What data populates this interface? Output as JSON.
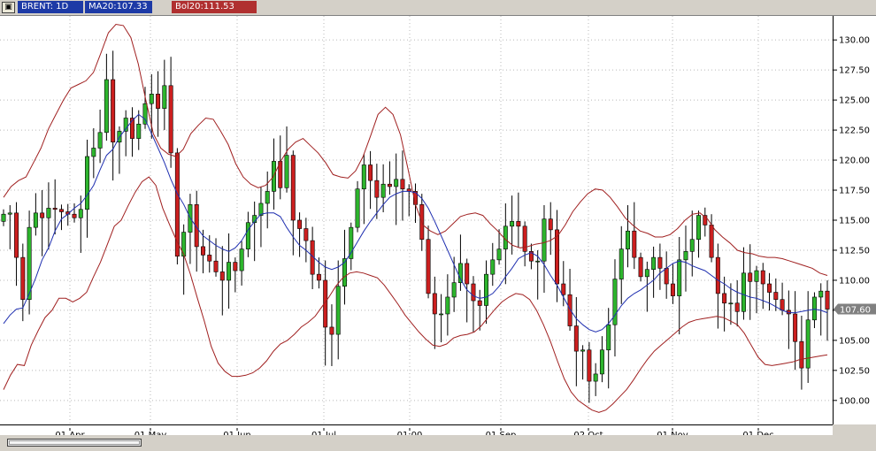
{
  "header": {
    "icon": "window-icon",
    "symbol_label": "BRENT: 1D",
    "ma_label": "MA20:107.33",
    "bol_label": "Bol20:111.53"
  },
  "colors": {
    "bull": "#2db52d",
    "bear": "#cc1f1f",
    "ma": "#1f2fb0",
    "bollinger": "#a02020",
    "grid": "#b8b8b8",
    "last_price_bg": "#808080"
  },
  "chart_data": {
    "type": "candlestick",
    "ylim": [
      98,
      132
    ],
    "y_ticks": [
      "100.00",
      "102.50",
      "105.00",
      "107.50",
      "110.00",
      "112.50",
      "115.00",
      "117.50",
      "120.00",
      "122.50",
      "125.00",
      "127.50",
      "130.00"
    ],
    "x_tick_labels": [
      "01 Apr",
      "01 May",
      "01 Jun",
      "01 Jul",
      "01:00",
      "01 Sep",
      "02 Oct",
      "01 Nov",
      "01 Dec"
    ],
    "last_price": "107.60",
    "grid": true,
    "close": [
      115.5,
      115.6,
      111.9,
      108.4,
      114.4,
      115.6,
      115.2,
      116.0,
      115.9,
      115.7,
      115.5,
      115.2,
      115.9,
      120.3,
      121.0,
      122.3,
      126.7,
      121.5,
      122.4,
      123.5,
      121.8,
      123.0,
      124.7,
      125.5,
      124.3,
      126.2,
      120.6,
      112.0,
      114.0,
      116.3,
      112.8,
      112.1,
      111.6,
      110.7,
      110.0,
      111.5,
      110.8,
      112.6,
      114.8,
      115.4,
      116.4,
      117.4,
      119.9,
      117.7,
      120.4,
      115.0,
      114.3,
      113.3,
      110.5,
      110.0,
      106.1,
      105.5,
      109.5,
      111.8,
      114.4,
      117.6,
      119.6,
      118.3,
      116.9,
      118.0,
      117.8,
      118.4,
      117.6,
      117.4,
      116.3,
      113.4,
      108.9,
      107.2,
      107.2,
      108.6,
      109.8,
      111.4,
      109.7,
      108.3,
      107.9,
      110.5,
      111.7,
      112.6,
      114.5,
      114.9,
      114.5,
      112.4,
      111.6,
      111.6,
      115.1,
      114.2,
      109.7,
      108.8,
      106.2,
      104.1,
      104.2,
      101.6,
      102.2,
      104.2,
      106.3,
      110.1,
      112.6,
      114.1,
      111.9,
      110.3,
      110.9,
      111.9,
      111.0,
      109.7,
      108.7,
      111.7,
      112.4,
      113.4,
      115.4,
      114.6,
      111.9,
      108.9,
      108.1,
      108.1,
      107.4,
      110.6,
      109.9,
      110.8,
      109.7,
      109.0,
      108.4,
      107.5,
      107.2,
      104.9,
      102.7,
      106.7,
      108.6,
      109.1,
      107.6
    ],
    "ma20": [
      106.4,
      107.1,
      107.6,
      107.7,
      108.9,
      110.2,
      111.7,
      112.7,
      114.1,
      115.1,
      115.5,
      116.0,
      116.4,
      117.1,
      117.9,
      119.2,
      120.4,
      120.9,
      121.9,
      122.6,
      123.3,
      123.8,
      123.4,
      122.2,
      121.0,
      119.8,
      118.4,
      117.2,
      116.3,
      115.2,
      114.4,
      113.7,
      113.3,
      112.9,
      112.6,
      112.4,
      112.7,
      113.3,
      114.2,
      114.9,
      115.5,
      115.6,
      115.6,
      115.3,
      114.4,
      113.6,
      112.9,
      112.5,
      112.0,
      111.5,
      111.1,
      110.9,
      111.1,
      111.5,
      112.3,
      113.2,
      114.1,
      114.9,
      115.6,
      116.3,
      116.9,
      117.2,
      117.4,
      117.4,
      117.3,
      116.8,
      116.0,
      114.9,
      113.7,
      112.5,
      111.3,
      110.1,
      109.2,
      108.7,
      108.5,
      108.6,
      108.9,
      109.5,
      110.3,
      111.0,
      111.8,
      112.1,
      112.3,
      112.0,
      111.3,
      110.4,
      109.6,
      108.6,
      107.6,
      106.8,
      106.3,
      105.9,
      105.7,
      105.9,
      106.4,
      107.1,
      107.9,
      108.5,
      108.9,
      109.2,
      109.6,
      110.0,
      110.6,
      111.0,
      111.4,
      111.6,
      111.5,
      111.2,
      111.0,
      110.8,
      110.4,
      110.0,
      109.7,
      109.3,
      109.0,
      108.8,
      108.6,
      108.5,
      108.3,
      108.1,
      107.8,
      107.5,
      107.3,
      107.3,
      107.4,
      107.5,
      107.6,
      107.5,
      107.3
    ],
    "bollinger_upper": [
      116.9,
      117.8,
      118.3,
      118.6,
      119.8,
      121.0,
      122.6,
      123.8,
      125.0,
      126.0,
      126.3,
      126.6,
      127.3,
      128.9,
      130.6,
      131.3,
      131.2,
      130.2,
      128.0,
      125.0,
      122.2,
      121.0,
      120.5,
      120.3,
      120.9,
      122.2,
      122.9,
      123.5,
      123.4,
      122.4,
      121.3,
      119.7,
      118.6,
      118.0,
      117.7,
      117.9,
      118.6,
      119.9,
      120.9,
      121.5,
      121.8,
      121.2,
      120.6,
      119.8,
      118.8,
      118.6,
      118.5,
      119.1,
      120.3,
      122.0,
      123.8,
      124.4,
      123.8,
      122.1,
      119.3,
      116.3,
      114.6,
      114.1,
      113.8,
      114.1,
      114.7,
      115.3,
      115.5,
      115.6,
      115.4,
      114.7,
      114.1,
      113.4,
      112.9,
      112.7,
      112.8,
      113.0,
      113.1,
      113.3,
      113.7,
      114.6,
      115.7,
      116.5,
      117.2,
      117.6,
      117.5,
      116.9,
      116.1,
      115.2,
      114.6,
      114.1,
      113.9,
      113.6,
      113.6,
      113.8,
      114.3,
      115.0,
      115.5,
      115.6,
      115.1,
      114.2,
      113.6,
      113.1,
      112.5,
      112.3,
      112.2,
      112.0,
      111.9,
      111.9,
      111.8,
      111.6,
      111.4,
      111.2,
      111.0,
      110.6,
      110.4
    ],
    "bollinger_lower": [
      100.9,
      102.1,
      103.0,
      102.9,
      104.6,
      105.8,
      106.9,
      107.5,
      108.5,
      108.5,
      108.2,
      108.5,
      109.0,
      110.3,
      111.5,
      113.0,
      114.5,
      115.0,
      116.2,
      117.3,
      118.2,
      118.6,
      117.9,
      116.0,
      114.6,
      113.3,
      112.2,
      110.5,
      108.5,
      106.6,
      104.5,
      103.1,
      102.4,
      102.0,
      102.0,
      102.1,
      102.3,
      102.7,
      103.3,
      104.1,
      104.7,
      105.0,
      105.5,
      106.1,
      106.5,
      107.0,
      107.8,
      108.6,
      109.5,
      110.2,
      110.6,
      110.7,
      110.6,
      110.4,
      110.2,
      109.6,
      108.8,
      108.0,
      107.1,
      106.4,
      105.7,
      105.1,
      104.6,
      104.5,
      104.7,
      105.2,
      105.4,
      105.5,
      105.7,
      106.2,
      106.9,
      107.6,
      108.2,
      108.6,
      108.9,
      108.8,
      108.4,
      107.5,
      106.3,
      104.9,
      103.3,
      101.8,
      100.7,
      100.0,
      99.6,
      99.2,
      99.0,
      99.2,
      99.7,
      100.3,
      100.9,
      101.7,
      102.6,
      103.4,
      104.1,
      104.6,
      105.1,
      105.6,
      106.1,
      106.5,
      106.7,
      106.8,
      106.9,
      107.0,
      106.9,
      106.6,
      106.3,
      105.6,
      104.6,
      103.6,
      103.0,
      102.9,
      103.0,
      103.1,
      103.2,
      103.4,
      103.5,
      103.6,
      103.7,
      103.8
    ]
  }
}
